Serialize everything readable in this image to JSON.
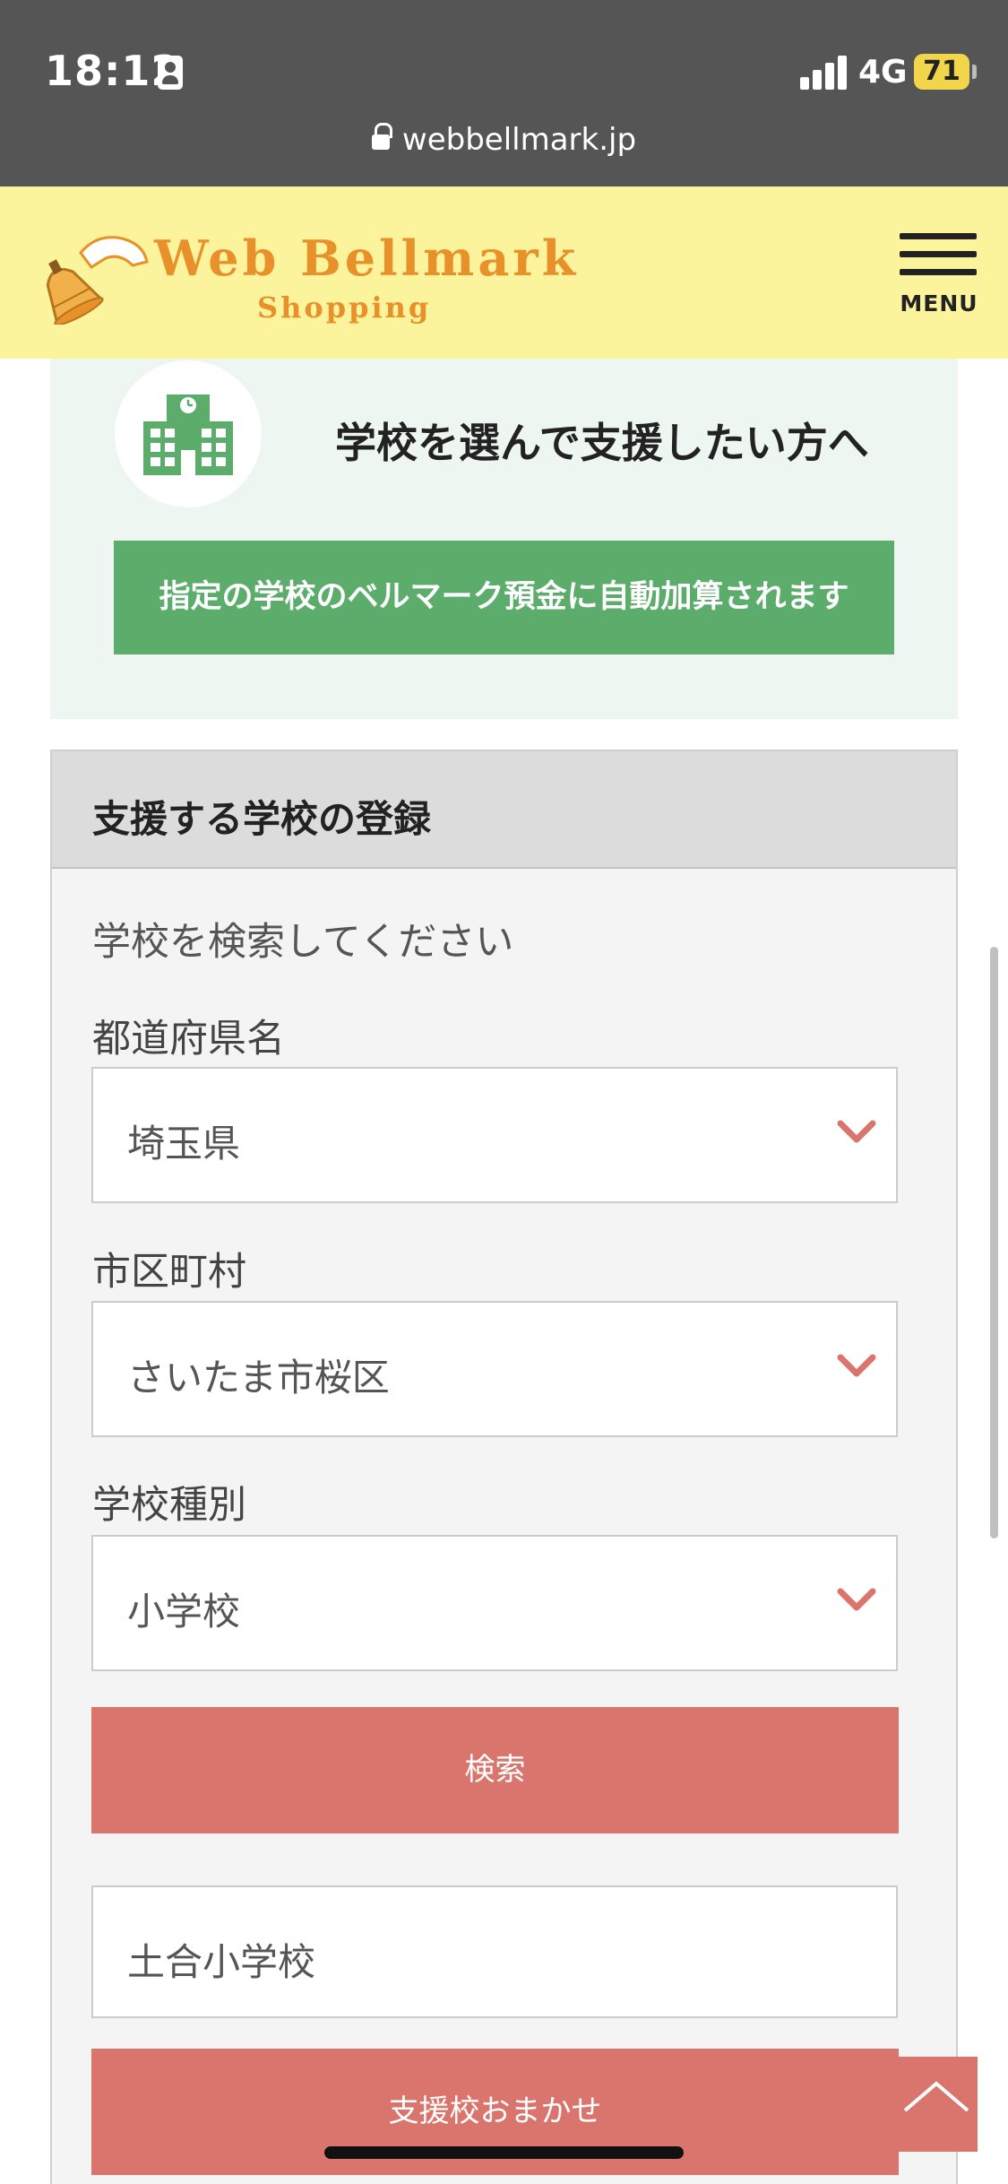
{
  "status_bar": {
    "time": "18:12",
    "network": "4G",
    "battery": "71",
    "url": "webbellmark.jp"
  },
  "header": {
    "brand": "Web Bellmark",
    "brand_sub": "Shopping",
    "menu_label": "MENU"
  },
  "intro": {
    "title": "学校を選んで支援したい方へ",
    "banner": "指定の学校のベルマーク預金に自動加算されます"
  },
  "registration": {
    "title": "支援する学校の登録",
    "search_hint": "学校を検索してください",
    "prefecture_label": "都道府県名",
    "prefecture_value": "埼玉県",
    "city_label": "市区町村",
    "city_value": "さいたま市桜区",
    "school_type_label": "学校種別",
    "school_type_value": "小学校",
    "search_button": "検索",
    "school_name_value": "土合小学校",
    "auto_button": "支援校おまかせ"
  },
  "colors": {
    "status_bar": "#555555",
    "header": "#fbf49c",
    "brand": "#e8912b",
    "green": "#5cac6c",
    "button": "#d9756c",
    "chevron": "#d9756c"
  },
  "icons": [
    "id-card-icon",
    "cellular-signal-icon",
    "lock-icon",
    "bell-logo-icon",
    "menu-icon",
    "school-building-icon",
    "chevron-down-icon",
    "arrow-up-icon"
  ]
}
